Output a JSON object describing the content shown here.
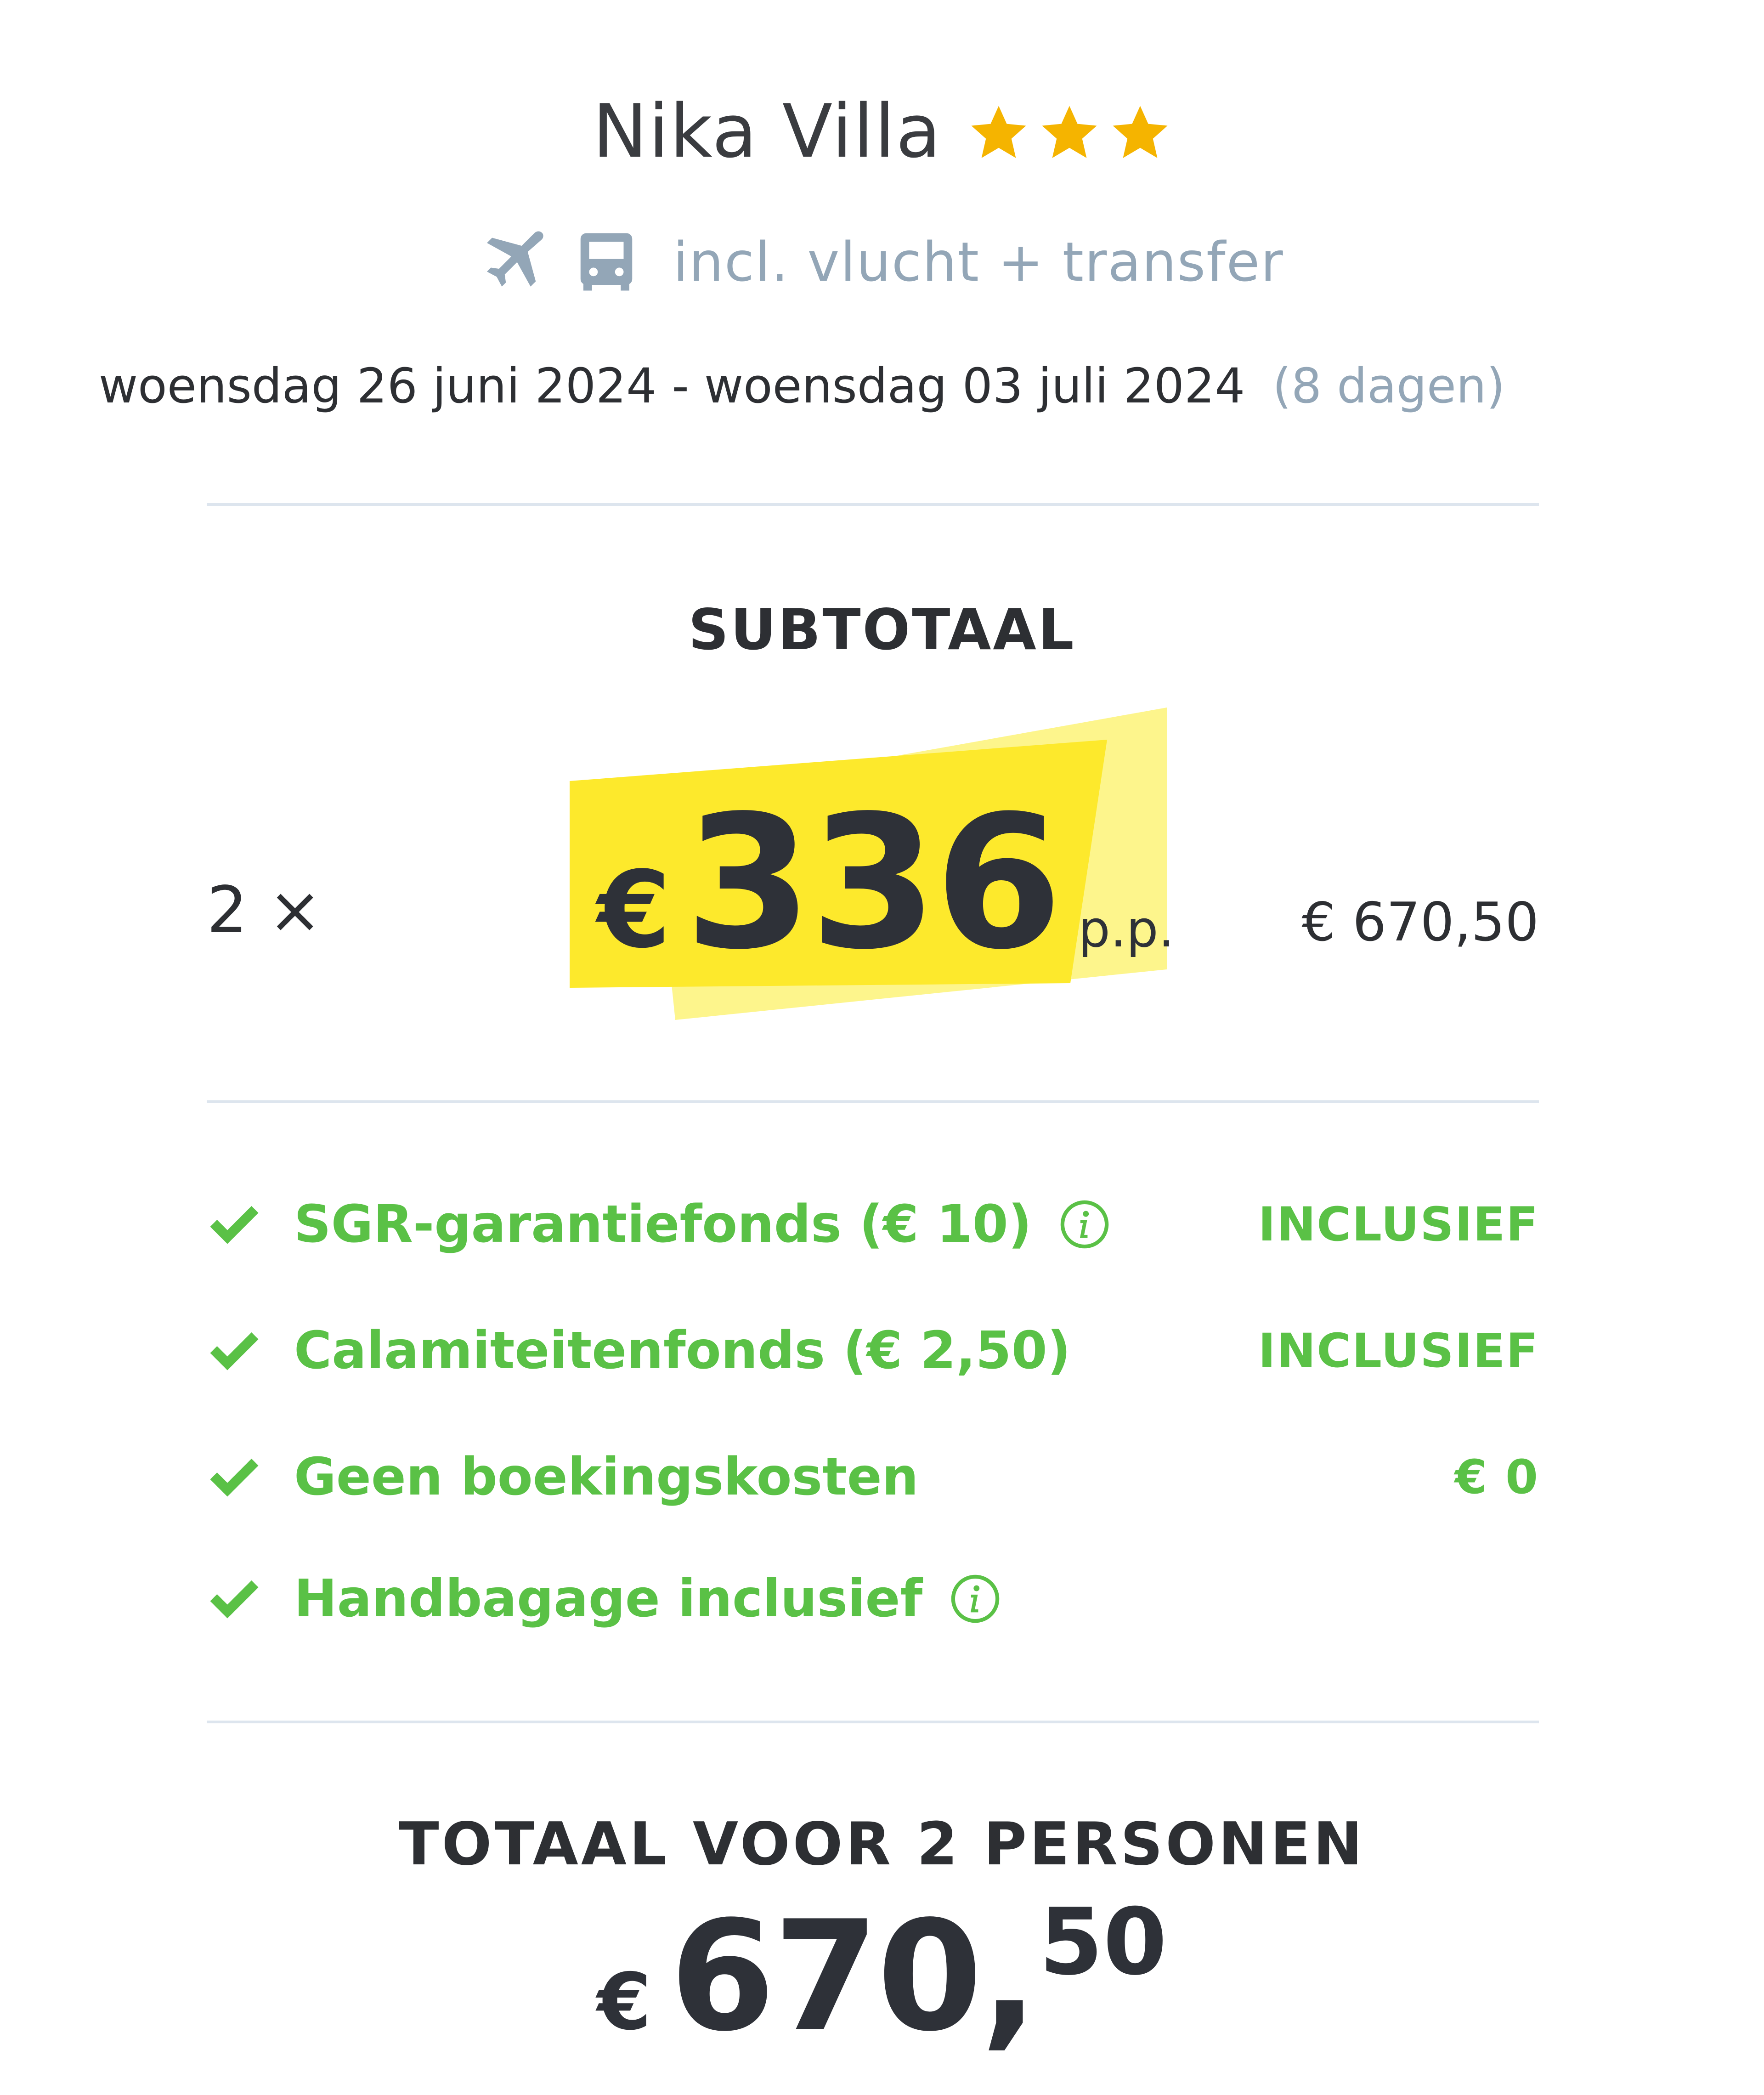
{
  "hotel": {
    "name": "Nika Villa",
    "stars": 3,
    "includes_text": "incl. vlucht + transfer",
    "includes_icons": [
      "plane-icon",
      "bus-icon"
    ]
  },
  "trip": {
    "dates": "woensdag 26 juni 2024 - woensdag 03 juli 2024",
    "duration": "(8 dagen)"
  },
  "subtotal": {
    "label": "SUBTOTAAL",
    "persons": "2 ×",
    "currency": "€",
    "price_pp": "336",
    "pp_label": "p.p.",
    "total": "€ 670,50"
  },
  "features": [
    {
      "label": "SGR-garantiefonds (€ 10)",
      "status": "INCLUSIEF",
      "info": true
    },
    {
      "label": "Calamiteitenfonds (€ 2,50)",
      "status": "INCLUSIEF",
      "info": false
    },
    {
      "label": "Geen boekingskosten",
      "status": "€ 0",
      "info": false
    },
    {
      "label": "Handbagage inclusief",
      "status": "",
      "info": true
    }
  ],
  "total": {
    "label": "TOTAAL VOOR 2 PERSONEN",
    "currency": "€",
    "integer": "670,",
    "decimals": "50"
  },
  "colors": {
    "star": "#f5b400",
    "muted": "#93a6b7",
    "green": "#5ac146",
    "highlight": "#fde92c",
    "divider": "#dde5ee"
  }
}
